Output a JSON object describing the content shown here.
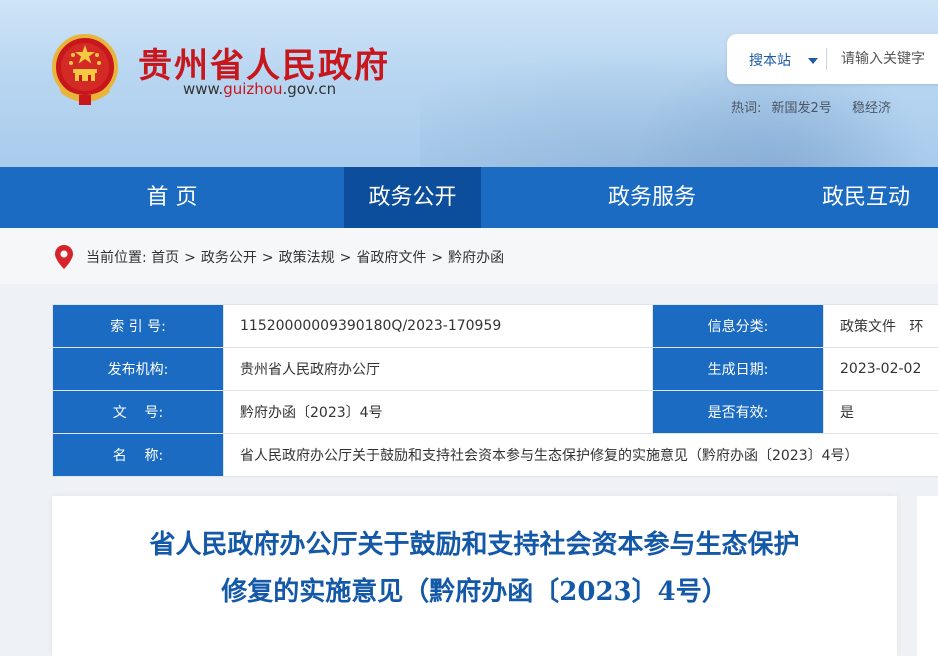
{
  "header": {
    "site_name": "贵州省人民政府",
    "site_url_prefix": "www.",
    "site_url_highlight": "guizhou",
    "site_url_suffix": ".gov.cn",
    "emblem_icon": "national-emblem-icon"
  },
  "search": {
    "scope_label": "搜本站",
    "placeholder": "请输入关键字"
  },
  "hotwords": {
    "label": "热词:",
    "items": [
      "新国发2号",
      "稳经济"
    ]
  },
  "nav": {
    "items": [
      "首 页",
      "政务公开",
      "政务服务",
      "政民互动"
    ],
    "active_index": 1
  },
  "breadcrumb": {
    "label": "当前位置:",
    "items": [
      "首页",
      "政务公开",
      "政策法规",
      "省政府文件",
      "黔府办函"
    ],
    "separator": ">",
    "icon": "location-pin-icon"
  },
  "info": {
    "index_label": "索 引 号:",
    "index_value": "11520000009390180Q/2023-170959",
    "category_label": "信息分类:",
    "category_value": "政策文件   环",
    "publisher_label": "发布机构:",
    "publisher_value": "贵州省人民政府办公厅",
    "date_label": "生成日期:",
    "date_value": "2023-02-02",
    "docno_label": "文    号:",
    "docno_value": "黔府办函〔2023〕4号",
    "valid_label": "是否有效:",
    "valid_value": "是",
    "name_label": "名    称:",
    "name_value": "省人民政府办公厅关于鼓励和支持社会资本参与生态保护修复的实施意见（黔府办函〔2023〕4号）"
  },
  "article": {
    "title_line1": "省人民政府办公厅关于鼓励和支持社会资本参与生态保护",
    "title_line2": "修复的实施意见（黔府办函〔2023〕4号）"
  },
  "colors": {
    "brand_red": "#c8161d",
    "nav_blue": "#1a6bc1",
    "nav_active": "#0c4e9c",
    "title_blue": "#1458a8"
  }
}
